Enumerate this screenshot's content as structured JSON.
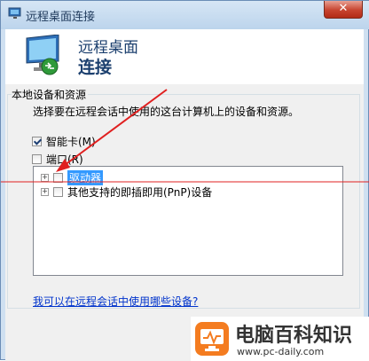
{
  "window": {
    "title": "远程桌面连接",
    "close_label": "✕"
  },
  "header": {
    "line1": "远程桌面",
    "line2": "连接"
  },
  "local_devices": {
    "section_title": "本地设备和资源",
    "description": "选择要在远程会话中使用的这台计算机上的设备和资源。",
    "smart_card": {
      "label": "智能卡(M)",
      "checked": true
    },
    "ports": {
      "label": "端口(R)",
      "checked": false
    },
    "tree_items": [
      {
        "label": "驱动器",
        "checked": false,
        "selected": true,
        "expander": "+"
      },
      {
        "label": "其他支持的即插即用(PnP)设备",
        "checked": false,
        "selected": false,
        "expander": "+"
      }
    ],
    "help_link": "我可以在远程会话中使用哪些设备?"
  },
  "watermark": {
    "name": "电脑百科知识",
    "url": "www.pc-daily.com"
  },
  "colors": {
    "title_text": "#1e395b",
    "header_text": "#1b3f6e",
    "link": "#0033cc",
    "annotation": "#e02020",
    "brand_accent": "#f47c20",
    "selection": "#3399ff"
  },
  "icons": {
    "title": "remote-desktop-icon",
    "header": "monitor-connection-icon",
    "close": "close-icon",
    "brand": "pc-daily-logo-icon"
  }
}
